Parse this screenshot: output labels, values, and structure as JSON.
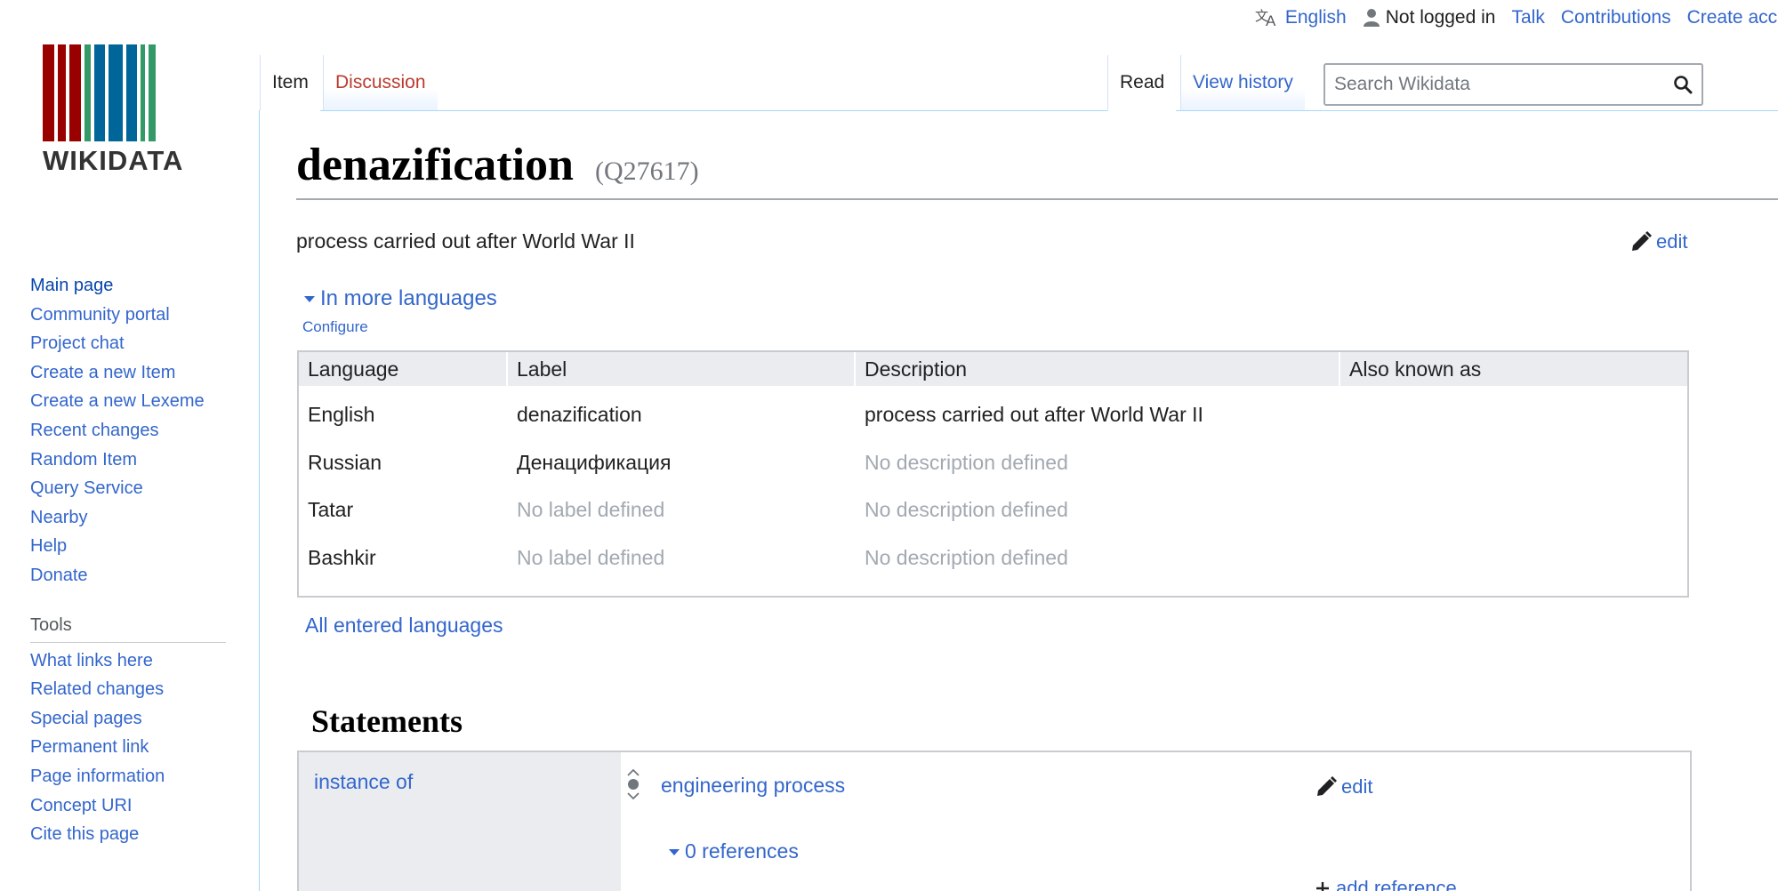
{
  "personal": {
    "language": "English",
    "not_logged_in": "Not logged in",
    "talk": "Talk",
    "contributions": "Contributions",
    "create_account": "Create account"
  },
  "logo": {
    "wordmark": "WIKIDATA",
    "bar_colors": [
      "#990000",
      "#990000",
      "#990000",
      "#339966",
      "#006699",
      "#006699",
      "#006699",
      "#339966",
      "#339966"
    ]
  },
  "sidebar": {
    "nav": [
      {
        "label": "Main page"
      },
      {
        "label": "Community portal"
      },
      {
        "label": "Project chat"
      },
      {
        "label": "Create a new Item"
      },
      {
        "label": "Create a new Lexeme"
      },
      {
        "label": "Recent changes"
      },
      {
        "label": "Random Item"
      },
      {
        "label": "Query Service"
      },
      {
        "label": "Nearby"
      },
      {
        "label": "Help"
      },
      {
        "label": "Donate"
      }
    ],
    "tools_heading": "Tools",
    "tools": [
      {
        "label": "What links here"
      },
      {
        "label": "Related changes"
      },
      {
        "label": "Special pages"
      },
      {
        "label": "Permanent link"
      },
      {
        "label": "Page information"
      },
      {
        "label": "Concept URI"
      },
      {
        "label": "Cite this page"
      }
    ]
  },
  "tabs": {
    "item": "Item",
    "discussion": "Discussion",
    "read": "Read",
    "view_history": "View history"
  },
  "search": {
    "placeholder": "Search Wikidata"
  },
  "page": {
    "title": "denazification",
    "id": "(Q27617)",
    "description": "process carried out after World War II",
    "edit_label": "edit",
    "more_languages": "In more languages",
    "configure": "Configure",
    "all_languages": "All entered languages"
  },
  "lang_table": {
    "headers": [
      "Language",
      "Label",
      "Description",
      "Also known as"
    ],
    "rows": [
      {
        "language": "English",
        "label": "denazification",
        "description": "process carried out after World War II",
        "aliases": ""
      },
      {
        "language": "Russian",
        "label": "Денацификация",
        "description": "No description defined",
        "aliases": ""
      },
      {
        "language": "Tatar",
        "label": "No label defined",
        "description": "No description defined",
        "aliases": ""
      },
      {
        "language": "Bashkir",
        "label": "No label defined",
        "description": "No description defined",
        "aliases": ""
      }
    ]
  },
  "statements": {
    "heading": "Statements",
    "property": "instance of",
    "value": "engineering process",
    "edit_label": "edit",
    "references": "0 references",
    "add_reference": "add reference"
  },
  "colors": {
    "link": "#3366cc",
    "new_link": "#ba3b2f",
    "placeholder_text": "#a2a9b1",
    "table_header_bg": "#eaecf0"
  }
}
